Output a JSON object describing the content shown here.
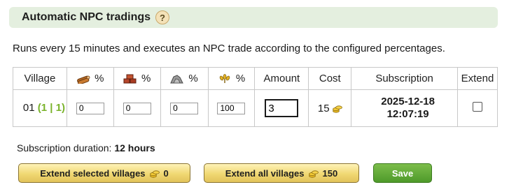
{
  "header": {
    "title": "Automatic NPC tradings",
    "help_icon": "?"
  },
  "description": "Runs every 15 minutes and executes an NPC trade according to the configured percentages.",
  "table": {
    "columns": {
      "village": "Village",
      "wood_pct": "%",
      "clay_pct": "%",
      "iron_pct": "%",
      "crop_pct": "%",
      "amount": "Amount",
      "cost": "Cost",
      "subscription": "Subscription",
      "extend": "Extend"
    },
    "icons": {
      "wood": "wood-resource-icon",
      "clay": "clay-resource-icon",
      "iron": "iron-resource-icon",
      "crop": "crop-resource-icon",
      "gold": "gold-coins-icon"
    },
    "row": {
      "village_name": "01",
      "village_coords": "(1 | 1)",
      "wood": "0",
      "clay": "0",
      "iron": "0",
      "crop": "100",
      "amount": "3",
      "cost": "15",
      "subscription_date": "2025-12-18",
      "subscription_time": "12:07:19",
      "extend_checked": false
    }
  },
  "duration": {
    "label": "Subscription duration:",
    "value": "12 hours"
  },
  "buttons": {
    "extend_selected": {
      "label": "Extend selected villages",
      "cost": "0"
    },
    "extend_all": {
      "label": "Extend all villages",
      "cost": "150"
    },
    "save": {
      "label": "Save"
    }
  },
  "colors": {
    "header_bg": "#e4efdf",
    "coords": "#7ab32b",
    "save_bg": "#5aa532",
    "gold_button": "#f0d873"
  }
}
